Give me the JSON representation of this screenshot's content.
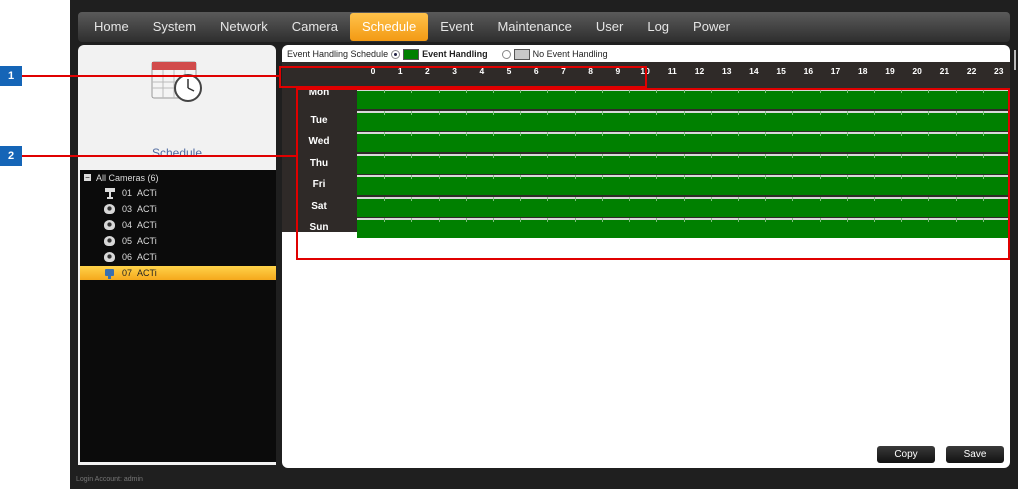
{
  "nav": {
    "items": [
      {
        "label": "Home",
        "active": false
      },
      {
        "label": "System",
        "active": false
      },
      {
        "label": "Network",
        "active": false
      },
      {
        "label": "Camera",
        "active": false
      },
      {
        "label": "Schedule",
        "active": true
      },
      {
        "label": "Event",
        "active": false
      },
      {
        "label": "Maintenance",
        "active": false
      },
      {
        "label": "User",
        "active": false
      },
      {
        "label": "Log",
        "active": false
      },
      {
        "label": "Power",
        "active": false
      }
    ]
  },
  "sidebar": {
    "title": "Schedule",
    "tree_root": "All Cameras (6)",
    "cameras": [
      {
        "number": "01",
        "name": "ACTi",
        "icon": "bullet-camera-icon",
        "selected": false
      },
      {
        "number": "03",
        "name": "ACTi",
        "icon": "dome-camera-icon",
        "selected": false
      },
      {
        "number": "04",
        "name": "ACTi",
        "icon": "dome-camera-icon",
        "selected": false
      },
      {
        "number": "05",
        "name": "ACTi",
        "icon": "dome-camera-icon",
        "selected": false
      },
      {
        "number": "06",
        "name": "ACTi",
        "icon": "dome-camera-icon",
        "selected": false
      },
      {
        "number": "07",
        "name": "ACTi",
        "icon": "box-camera-icon",
        "selected": true
      }
    ]
  },
  "legend": {
    "schedule_label": "Event Handling Schedule",
    "on_label": "Event Handling",
    "off_label": "No Event Handling",
    "on_color": "#008000",
    "off_color": "#c8c8c8"
  },
  "schedule": {
    "hours": [
      "0",
      "1",
      "2",
      "3",
      "4",
      "5",
      "6",
      "7",
      "8",
      "9",
      "10",
      "11",
      "12",
      "13",
      "14",
      "15",
      "16",
      "17",
      "18",
      "19",
      "20",
      "21",
      "22",
      "23"
    ],
    "days": [
      "Mon",
      "Tue",
      "Wed",
      "Thu",
      "Fri",
      "Sat",
      "Sun"
    ]
  },
  "callouts": [
    "1",
    "2"
  ],
  "buttons": {
    "copy": "Copy",
    "save": "Save"
  },
  "status": {
    "login": "Login Account: admin"
  },
  "colors": {
    "accent": "#f5a81c",
    "callout": "#1565b7",
    "highlight": "#e00000"
  }
}
